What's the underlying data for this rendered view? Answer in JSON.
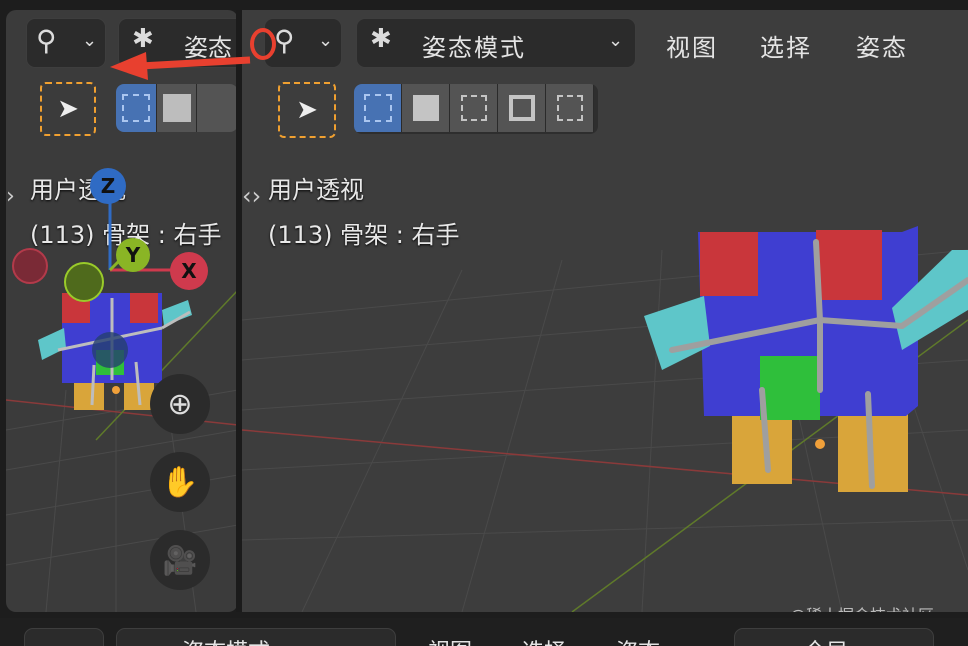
{
  "header": {
    "mode_label": "姿态模式",
    "mode_label_short": "姿态",
    "menu": [
      "视图",
      "选择",
      "姿态"
    ]
  },
  "overlay": {
    "view_name": "用户透视",
    "object_info": "(113) 骨架 : 右手"
  },
  "gizmo_axes": {
    "z": "Z",
    "y": "Y",
    "x": "X"
  },
  "bottom_bar": {
    "mode_label": "姿态模式",
    "menu": [
      "视图",
      "选择",
      "姿态"
    ],
    "last_label": "全局"
  },
  "watermark": "@稀土掘金技术社区",
  "colors": {
    "viewport_bg": "#3d3d3d",
    "header_bg": "#303030",
    "active_select": "#4772b3",
    "annotation_red": "#e8402f",
    "gizmo_x": "#cf3a4d",
    "gizmo_y": "#8ab525",
    "gizmo_z": "#2f6bc4"
  }
}
